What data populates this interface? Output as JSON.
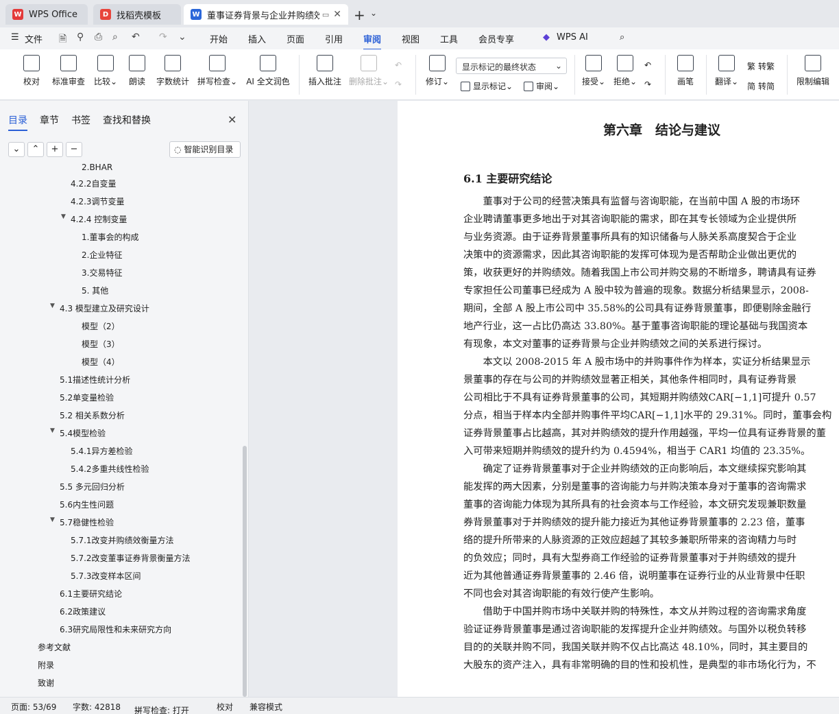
{
  "tabs": {
    "wps": "WPS Office",
    "template": "找稻壳模板",
    "doc": "董事证券背景与企业并购绩效"
  },
  "menu": {
    "file": "文件",
    "items": [
      "开始",
      "插入",
      "页面",
      "引用",
      "审阅",
      "视图",
      "工具",
      "会员专享"
    ],
    "wps_ai": "WPS AI"
  },
  "ribbon": {
    "proofread": "校对",
    "standard_review": "标准审查",
    "compare": "比较",
    "read_aloud": "朗读",
    "word_count": "字数统计",
    "spell_check": "拼写检查",
    "ai_polish": "AI 全文润色",
    "insert_comment": "插入批注",
    "delete_comment": "删除批注",
    "track_changes": "修订",
    "markup_mode": "显示标记的最终状态",
    "show_markup": "显示标记",
    "review": "审阅",
    "accept": "接受",
    "reject": "拒绝",
    "pen": "画笔",
    "translate": "翻译",
    "to_traditional": "转繁",
    "to_simplified": "转简",
    "restrict_edit": "限制编辑"
  },
  "sidebar": {
    "tabs": [
      "目录",
      "章节",
      "书签",
      "查找和替换"
    ],
    "smart_toc": "智能识别目录",
    "toc": [
      "2.BHAR",
      "4.2.2自变量",
      "4.2.3调节变量",
      "4.2.4 控制变量",
      "1.董事会的构成",
      "2.企业特征",
      "3.交易特征",
      "5. 其他",
      "4.3 模型建立及研究设计",
      "模型（2）",
      "模型（3）",
      "模型（4）",
      "5.1描述性统计分析",
      "5.2单变量检验",
      "5.2 相关系数分析",
      "5.4模型检验",
      "5.4.1异方差检验",
      "5.4.2多重共线性检验",
      "5.5 多元回归分析",
      "5.6内生性问题",
      "5.7稳健性检验",
      "5.7.1改变并购绩效衡量方法",
      "5.7.2改变董事证券背景衡量方法",
      "5.7.3改变样本区间",
      "6.1主要研究结论",
      "6.2政策建议",
      "6.3研究局限性和未来研究方向",
      "参考文献",
      "附录",
      "致谢"
    ]
  },
  "document": {
    "chapter_title": "第六章　结论与建议",
    "section_title": "6.1  主要研究结论",
    "lines": [
      "　　董事对于公司的经营决策具有监督与咨询职能，在当前中国  A 股的市场环",
      "企业聘请董事更多地出于对其咨询职能的需求，即在其专长领域为企业提供所",
      "与业务资源。由于证券背景董事所具有的知识储备与人脉关系高度契合于企业",
      "决策中的资源需求，因此其咨询职能的发挥可体现为是否帮助企业做出更优的",
      "策，收获更好的并购绩效。随着我国上市公司并购交易的不断增多，聘请具有证券",
      "专家担任公司董事已经成为  A 股中较为普遍的现象。数据分析结果显示，2008-",
      "期间，全部 A 股上市公司中 35.58%的公司具有证券背景董事，即便剔除金融行",
      "地产行业，这一占比仍高达 33.80%。基于董事咨询职能的理论基础与我国资本",
      "有现象，本文对董事的证券背景与企业并购绩效之间的关系进行探讨。",
      "　　本文以  2008-2015 年  A 股市场中的并购事件作为样本，实证分析结果显示",
      "景董事的存在与公司的并购绩效显著正相关，其他条件相同时，具有证券背景",
      "公司相比于不具有证券背景董事的公司，其短期并购绩效CAR[−1,1]可提升  0.57",
      "分点，相当于样本内全部并购事件平均CAR[−1,1]水平的  29.31%。同时，董事会构",
      "证券背景董事占比越高，其对并购绩效的提升作用越强，平均一位具有证券背景的董",
      "入可带来短期并购绩效的提升约为  0.4594%，相当于  CAR1 均值的 23.35%。",
      "　　确定了证券背景董事对于企业并购绩效的正向影响后，本文继续探究影响其",
      "能发挥的两大因素，分别是董事的咨询能力与并购决策本身对于董事的咨询需求",
      "董事的咨询能力体现为其所具有的社会资本与工作经验，本文研究发现兼职数量",
      "券背景董事对于并购绩效的提升能力接近为其他证券背景董事的  2.23 倍，董事",
      "络的提升所带来的人脉资源的正效应超越了其较多兼职所带来的咨询精力与时",
      "的负效应；同时，具有大型券商工作经验的证券背景董事对于并购绩效的提升",
      "近为其他普通证券背景董事的  2.46 倍，说明董事在证券行业的从业背景中任职",
      "不同也会对其咨询职能的有效行使产生影响。",
      "　　借助于中国并购市场中关联并购的特殊性，本文从并购过程的咨询需求角度",
      "验证证券背景董事是通过咨询职能的发挥提升企业并购绩效。与国外以税负转移",
      "目的的关联并购不同，我国关联并购不仅占比高达  48.10%，同时，其主要目的",
      "大股东的资产注入，具有非常明确的目的性和投机性，是典型的非市场化行为，不"
    ]
  },
  "status": {
    "page": "页面: 53/69",
    "words": "字数: 42818",
    "spell": "拼写检查: 打开",
    "proof": "校对",
    "compat": "兼容模式"
  },
  "colors": {
    "accent": "#2a5fd6",
    "wps_red": "#e33a3a",
    "doc_blue": "#2b67d9"
  }
}
